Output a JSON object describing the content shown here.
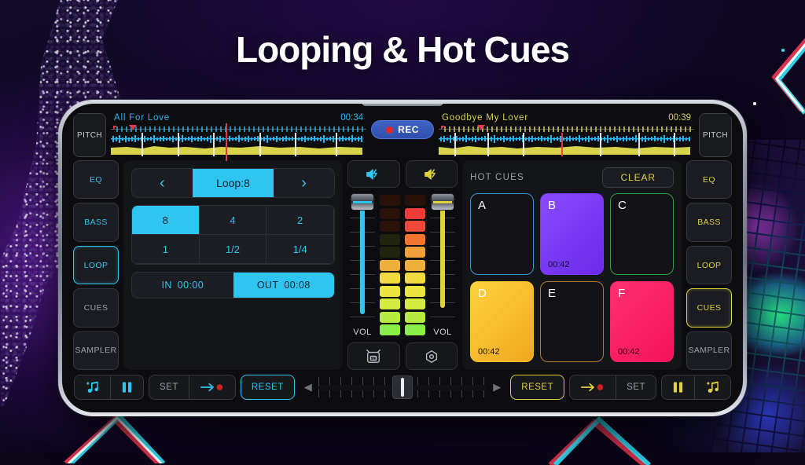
{
  "heading": "Looping & Hot Cues",
  "colors": {
    "cyan": "#2ec5f0",
    "yellow": "#ded23d",
    "rec_blue": "#3f63c4",
    "red": "#e5394b",
    "panel": "#141519"
  },
  "decks": {
    "left": {
      "pitch_label": "PITCH",
      "track_name": "All For Love",
      "time": "00:34",
      "accent": "#29b6ec",
      "side_buttons": [
        {
          "label": "EQ",
          "state": "cyan"
        },
        {
          "label": "BASS",
          "state": "cyan"
        },
        {
          "label": "LOOP",
          "state": "active-cyan"
        },
        {
          "label": "CUES",
          "state": "dim"
        },
        {
          "label": "SAMPLER",
          "state": "dim"
        }
      ]
    },
    "right": {
      "pitch_label": "PITCH",
      "track_name": "Goodbye My Lover",
      "time": "00:39",
      "accent": "#d8d34a",
      "side_buttons": [
        {
          "label": "EQ",
          "state": "yellow"
        },
        {
          "label": "BASS",
          "state": "yellow"
        },
        {
          "label": "LOOP",
          "state": "yellow"
        },
        {
          "label": "CUES",
          "state": "active-yellow"
        },
        {
          "label": "SAMPLER",
          "state": "dim"
        }
      ]
    }
  },
  "rec": {
    "label": "REC"
  },
  "loop_panel": {
    "prev_icon": "chevron-left-icon",
    "next_icon": "chevron-right-icon",
    "current": "Loop:8",
    "sizes": [
      {
        "label": "8",
        "selected": true
      },
      {
        "label": "4",
        "selected": false
      },
      {
        "label": "2",
        "selected": false
      },
      {
        "label": "1",
        "selected": false
      },
      {
        "label": "1/2",
        "selected": false
      },
      {
        "label": "1/4",
        "selected": false
      }
    ],
    "in_label": "IN",
    "in_time": "00:00",
    "out_label": "OUT",
    "out_time": "00:08",
    "out_active": true
  },
  "mixer": {
    "left_cue_icon": "speaker-cue-icon",
    "right_cue_icon": "speaker-cue-icon",
    "left_vol_label": "VOL",
    "right_vol_label": "VOL",
    "left_fader_pct": 82,
    "right_fader_pct": 78,
    "ad_icon": "ad-icon",
    "settings_icon": "settings-icon",
    "led_left": [
      "#2a1208",
      "#2a1208",
      "#2a1208",
      "#22230c",
      "#22230c",
      "#f0ae3a",
      "#f2d940",
      "#e9e53e",
      "#d3ea3e",
      "#b6ec3f",
      "#8cee49"
    ],
    "led_right": [
      "#2a1208",
      "#ef3c36",
      "#ef4a39",
      "#f4752e",
      "#f0a03a",
      "#f0ae3a",
      "#f2d940",
      "#e9e53e",
      "#d3ea3e",
      "#b6ec3f",
      "#8cee49"
    ]
  },
  "hot_cues": {
    "title": "HOT CUES",
    "clear_label": "CLEAR",
    "pads": [
      {
        "letter": "A",
        "time": "",
        "fill": "",
        "border": "#3b93c9",
        "filled": false
      },
      {
        "letter": "B",
        "time": "00:42",
        "fill": "#7a3cf2",
        "border": "#7a3cf2",
        "filled": true
      },
      {
        "letter": "C",
        "time": "",
        "fill": "",
        "border": "#2f9e41",
        "filled": false
      },
      {
        "letter": "D",
        "time": "00:42",
        "fill": "#f5c22a",
        "border": "#f5c22a",
        "filled": true
      },
      {
        "letter": "E",
        "time": "",
        "fill": "",
        "border": "#b5792a",
        "filled": false
      },
      {
        "letter": "F",
        "time": "00:42",
        "fill": "#f72466",
        "border": "#f72466",
        "filled": true
      }
    ]
  },
  "transport": {
    "left": {
      "add_track_icon": "add-music-icon",
      "pause_icon": "pause-icon",
      "set_label": "SET",
      "cue_jump_icon": "arrow-to-cue-icon",
      "reset_label": "RESET"
    },
    "crossfader": {
      "left_arrow_icon": "triangle-left-icon",
      "right_arrow_icon": "triangle-right-icon",
      "position_pct": 50
    },
    "right": {
      "reset_label": "RESET",
      "cue_jump_icon": "arrow-to-cue-icon",
      "set_label": "SET",
      "pause_icon": "pause-icon",
      "add_track_icon": "add-music-icon"
    }
  }
}
